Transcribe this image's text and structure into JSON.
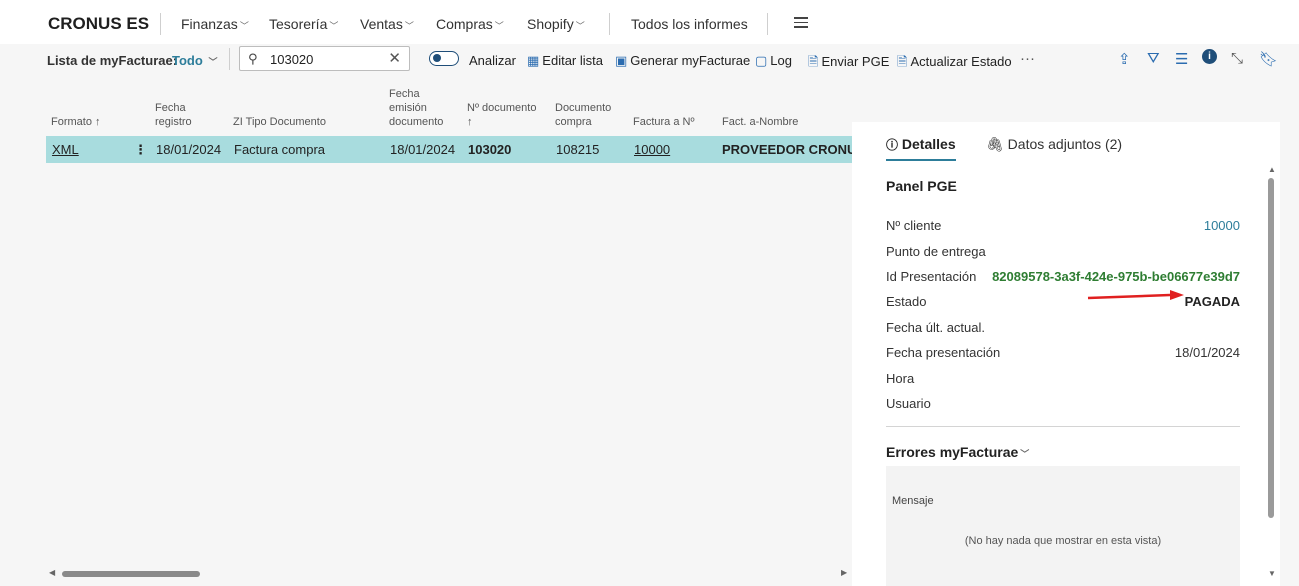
{
  "top_nav": {
    "brand": "CRONUS ES",
    "items": [
      "Finanzas",
      "Tesorería",
      "Ventas",
      "Compras",
      "Shopify"
    ],
    "all_reports": "Todos los informes"
  },
  "action_bar": {
    "list_label": "Lista de myFacturae:",
    "filter_value": "Todo",
    "search_value": "103020",
    "analyze": "Analizar",
    "edit_list": "Editar lista",
    "generate": "Generar myFacturae",
    "log": "Log",
    "send": "Enviar PGE",
    "update_status": "Actualizar Estado",
    "more": "···"
  },
  "columns": [
    "Formato ↑",
    "Fecha registro",
    "ZI Tipo Documento",
    "Fecha emisión documento",
    "Nº documento ↑",
    "Documento compra",
    "Factura a Nº",
    "Fact. a-Nombre"
  ],
  "row": {
    "formato": "XML",
    "menu": "⋮",
    "fecha_registro": "18/01/2024",
    "tipo_documento": "Factura compra",
    "fecha_emision": "18/01/2024",
    "num_documento": "103020",
    "documento_compra": "108215",
    "factura_a": "10000",
    "nombre": "PROVEEDOR CRONU..."
  },
  "panel": {
    "tab_details": "Detalles",
    "tab_attachments": "Datos adjuntos (2)",
    "title": "Panel PGE",
    "fields": {
      "cliente_label": "Nº cliente",
      "cliente_value": "10000",
      "punto_label": "Punto de entrega",
      "id_label": "Id Presentación",
      "id_value": "82089578-3a3f-424e-975b-be06677e39d7",
      "estado_label": "Estado",
      "estado_value": "PAGADA",
      "fecha_ult_label": "Fecha últ. actual.",
      "fecha_pres_label": "Fecha presentación",
      "fecha_pres_value": "18/01/2024",
      "hora_label": "Hora",
      "usuario_label": "Usuario"
    },
    "errors_title": "Errores myFacturae",
    "message_header": "Mensaje",
    "empty_text": "(No hay nada que mostrar en esta vista)"
  },
  "colors": {
    "accent": "#2d7d9a",
    "row_selected": "#a8dcde",
    "id_green": "#2e7d32",
    "arrow": "#e02020"
  }
}
